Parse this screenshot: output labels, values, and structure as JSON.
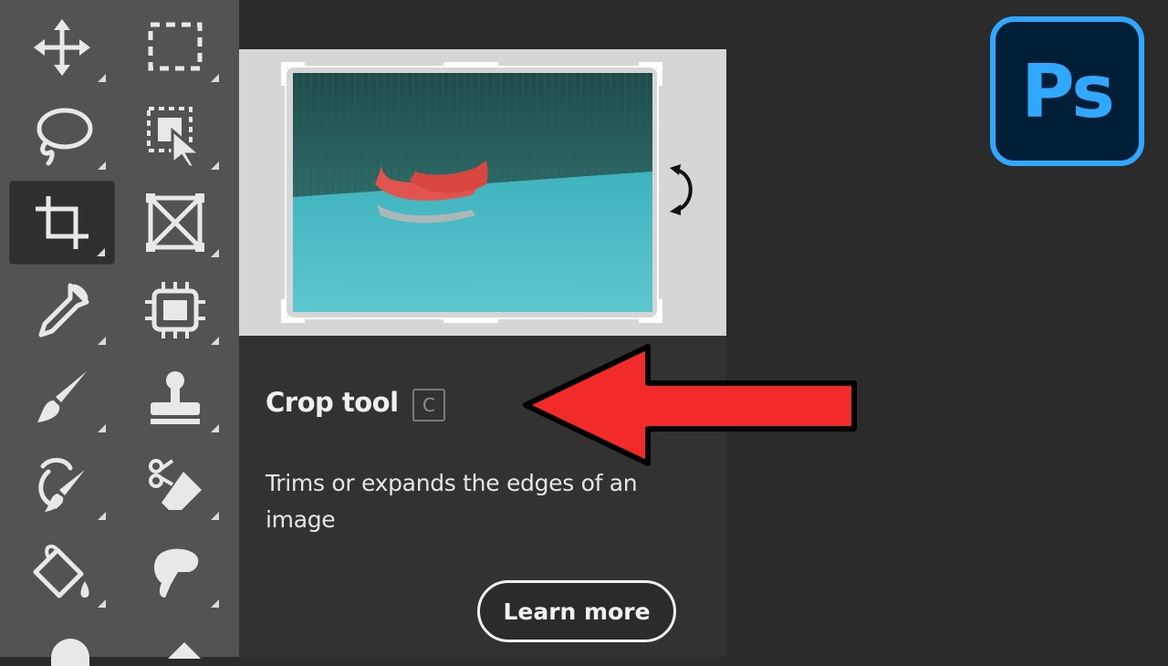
{
  "tooltip": {
    "title": "Crop tool",
    "shortcut": "C",
    "description": "Trims or expands the edges of an image",
    "learn_more_label": "Learn more"
  },
  "logo": {
    "text": "Ps",
    "color": "#31a8ff",
    "background": "#001e36"
  },
  "toolbar": {
    "tools": [
      {
        "name": "move-icon",
        "active": false
      },
      {
        "name": "rectangular-marquee-icon",
        "active": false
      },
      {
        "name": "lasso-icon",
        "active": false
      },
      {
        "name": "object-selection-icon",
        "active": false
      },
      {
        "name": "crop-icon",
        "active": true
      },
      {
        "name": "frame-icon",
        "active": false
      },
      {
        "name": "eyedropper-icon",
        "active": false
      },
      {
        "name": "spot-healing-icon",
        "active": false
      },
      {
        "name": "brush-icon",
        "active": false
      },
      {
        "name": "clone-stamp-icon",
        "active": false
      },
      {
        "name": "history-brush-icon",
        "active": false
      },
      {
        "name": "eraser-icon",
        "active": false
      },
      {
        "name": "paint-bucket-icon",
        "active": false
      },
      {
        "name": "smudge-icon",
        "active": false
      }
    ]
  },
  "colors": {
    "annotation_arrow": "#f22a2a",
    "toolbar": "#535353",
    "panel": "#323232"
  }
}
